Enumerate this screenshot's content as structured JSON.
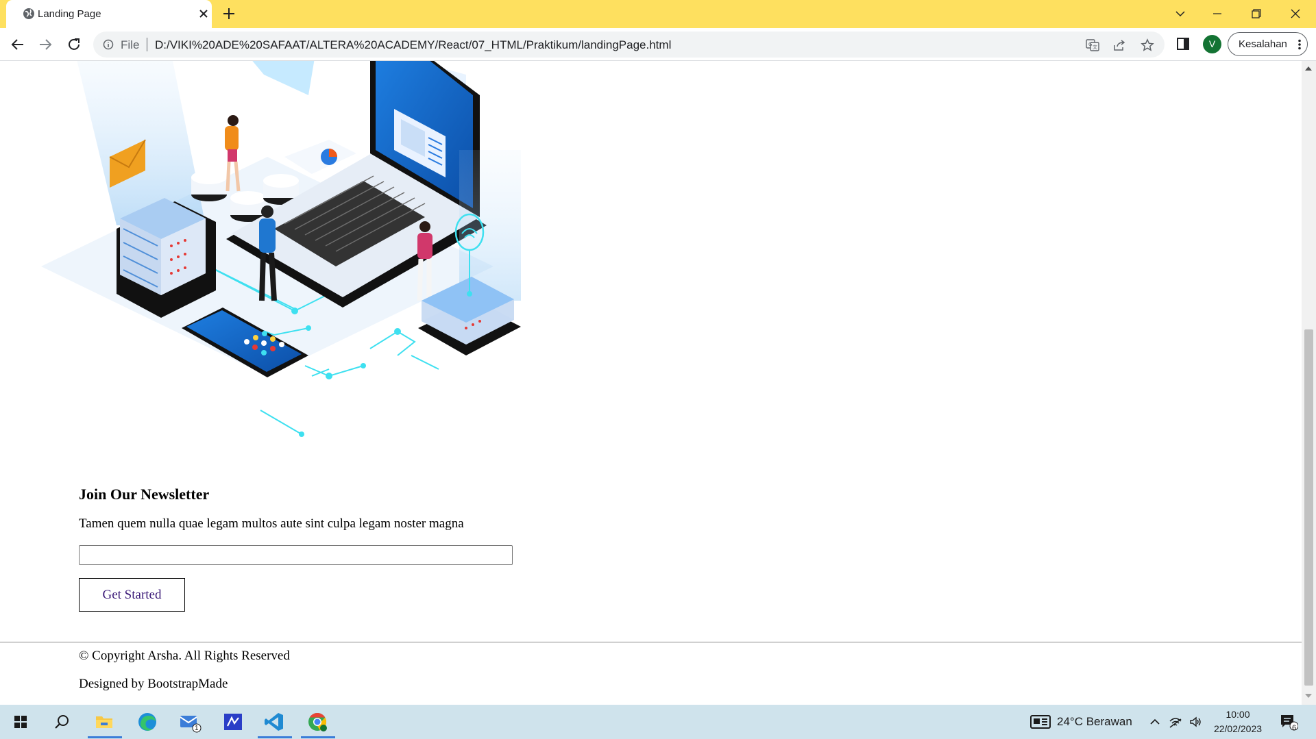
{
  "browser": {
    "tab_title": "Landing Page",
    "file_label": "File",
    "url": "D:/VIKI%20ADE%20SAFAAT/ALTERA%20ACADEMY/React/07_HTML/Praktikum/landingPage.html",
    "profile_initial": "V",
    "error_chip_label": "Kesalahan"
  },
  "page": {
    "newsletter_heading": "Join Our Newsletter",
    "newsletter_text": "Tamen quem nulla quae legam multos aute sint culpa legam noster magna",
    "email_value": "",
    "button_label": "Get Started",
    "copyright": "© Copyright Arsha. All Rights Reserved",
    "designed_by": "Designed by BootstrapMade"
  },
  "taskbar": {
    "weather": "24°C  Berawan",
    "time": "10:00",
    "date": "22/02/2023",
    "mail_badge": "1",
    "notification_count": "6"
  },
  "colors": {
    "tabstrip": "#fee05f",
    "taskbar": "#cfe3ec",
    "button_text": "#3b1a78",
    "avatar": "#137333"
  },
  "icons": [
    "globe-icon",
    "close-icon",
    "plus-icon",
    "chevron-down-icon",
    "minimize-icon",
    "restore-icon",
    "back-arrow-icon",
    "forward-arrow-icon",
    "reload-icon",
    "info-icon",
    "translate-icon",
    "share-icon",
    "star-icon",
    "side-panel-icon",
    "kebab-menu-icon",
    "windows-start-icon",
    "search-icon",
    "file-explorer-icon",
    "edge-icon",
    "mail-icon",
    "visual-studio-icon",
    "vscode-icon",
    "chrome-icon",
    "weather-icon",
    "network-icon",
    "volume-icon",
    "notification-icon"
  ]
}
